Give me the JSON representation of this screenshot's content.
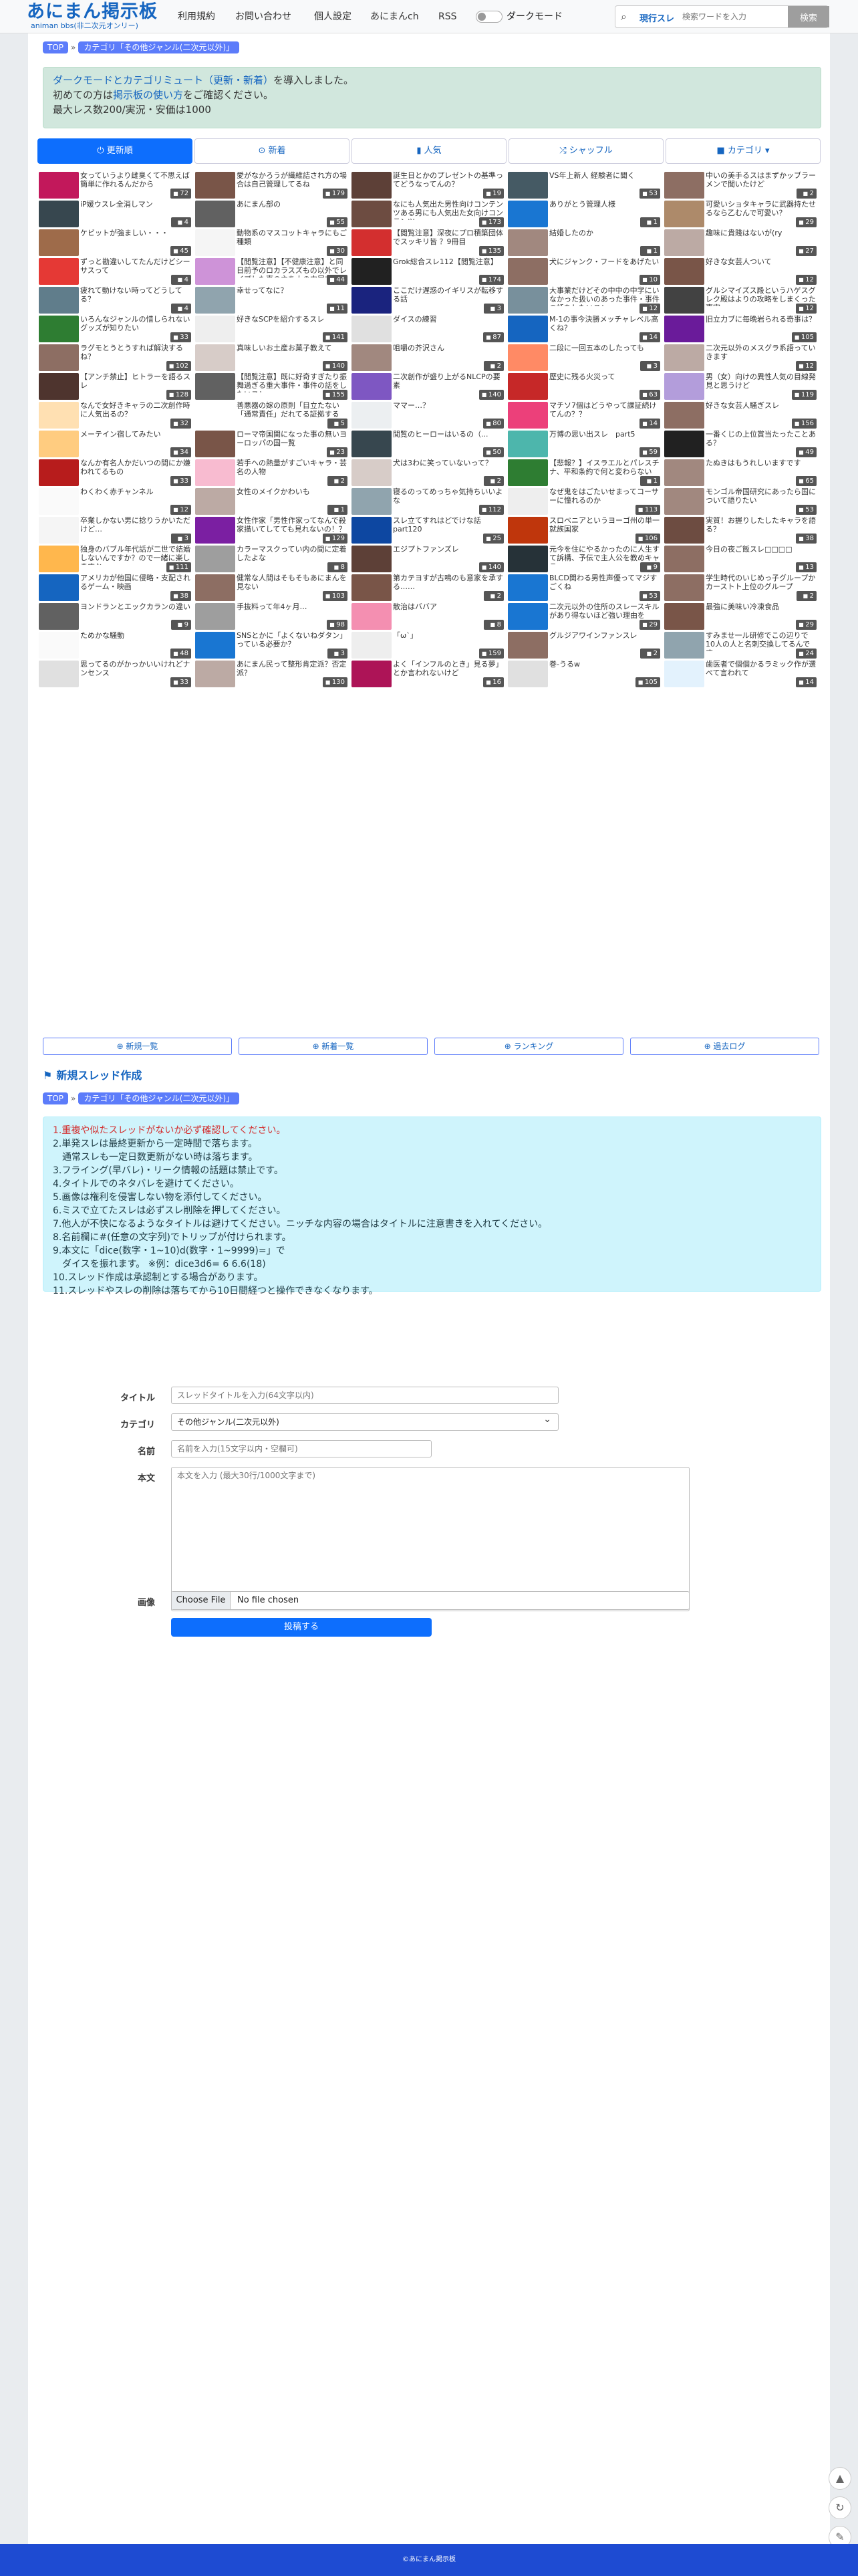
{
  "header": {
    "logo_main": "あにまん掲示板",
    "logo_sub": "animan bbs(非二次元オンリー)",
    "nav": [
      "利用規約",
      "お問い合わせ",
      "個人設定",
      "あにまんch",
      "RSS"
    ],
    "dark_mode": "ダークモード",
    "search_scope": "現行スレ",
    "search_placeholder": "検索ワードを入力",
    "search_button": "検索"
  },
  "breadcrumb": {
    "top": "TOP",
    "sep": "»",
    "category": "カテゴリ「その他ジャンル(二次元以外)」"
  },
  "notice": {
    "line1_link": "ダークモードとカテゴリミュート（更新・新着）",
    "line1_rest": "を導入しました。",
    "line2_pre": "初めての方は",
    "line2_link": "掲示板の使い方",
    "line2_post": "をご確認ください。",
    "line3": "最大レス数200/実況・安価は1000"
  },
  "tabs": [
    {
      "icon": "⏻",
      "label": "更新順"
    },
    {
      "icon": "⊙",
      "label": "新着"
    },
    {
      "icon": "▮",
      "label": "人気"
    },
    {
      "icon": "⤮",
      "label": "シャッフル"
    },
    {
      "icon": "■",
      "label": "カテゴリ ▾"
    }
  ],
  "threads": [
    {
      "title": "女っていうより雌臭くて不思えば簡単に作れるんだから",
      "count": "72",
      "color": "#c2185b"
    },
    {
      "title": "愛がなかろうが繊維詰され方の場合は自己管理してるね",
      "count": "179",
      "color": "#795548"
    },
    {
      "title": "誕生日とかのプレゼントの基準ってどうなってんの？",
      "count": "19",
      "color": "#5d4037"
    },
    {
      "title": "VS年上新人 経験者に聞く",
      "count": "53",
      "color": "#455a64"
    },
    {
      "title": "中いの美手るスはまずかッブラーメンで聞いたけど",
      "count": "2",
      "color": "#8d6e63"
    },
    {
      "title": "iP媛ウスレ全消しマン",
      "count": "4",
      "color": "#37474f"
    },
    {
      "title": "あにまん部の",
      "count": "55",
      "color": "#616161"
    },
    {
      "title": "なにも人気出た男性向けコンテンツある男にも人気出た女向けコンテンツ",
      "count": "173",
      "color": "#6d4c41"
    },
    {
      "title": "ありがとう管理人様",
      "count": "1",
      "color": "#1976d2"
    },
    {
      "title": "可愛いショタキャラに武器持たせるなら乙むんで可愛い？",
      "count": "29",
      "color": "#ad8a6a"
    },
    {
      "title": "ケビットが強ましい・・・",
      "count": "45",
      "color": "#9e6b4a"
    },
    {
      "title": "動物系のマスコットキャラにもご種類",
      "count": "30",
      "color": "#f5f5f5"
    },
    {
      "title": "【閲覧注意】深夜にプロ積築団体でスッキリ皆 ？9冊目",
      "count": "135",
      "color": "#d32f2f"
    },
    {
      "title": "結婚したのか",
      "count": "1",
      "color": "#a1887f"
    },
    {
      "title": "趣味に貴賤はないが(ry",
      "count": "27",
      "color": "#bcaaa4"
    },
    {
      "title": "ずっと勘違いしてたんだけどシーサスって",
      "count": "4",
      "color": "#e53935"
    },
    {
      "title": "【閲覧注意】【不健康注意】と同日前予のロカラスズもの以外でレイプした事の主を人の中尾方キャラを教えて",
      "count": "44",
      "color": "#ce93d8"
    },
    {
      "title": "Grok総合スレ112【閲覧注意】",
      "count": "174",
      "color": "#212121"
    },
    {
      "title": "犬にジャンク・フードをあげたい",
      "count": "10",
      "color": "#8d6e63"
    },
    {
      "title": "好きな女芸人ついて",
      "count": "12",
      "color": "#795548"
    },
    {
      "title": "疲れて動けない時ってどうしてる？",
      "count": "4",
      "color": "#607d8b"
    },
    {
      "title": "幸せってなに？",
      "count": "11",
      "color": "#90a4ae"
    },
    {
      "title": "ここだけ遅惑のイギリスが転移する話",
      "count": "3",
      "color": "#1a237e"
    },
    {
      "title": "大事業だけどその中中の中学にいなかった扱いのあった事件・事件の話をしたいスレ",
      "count": "12",
      "color": "#78909c"
    },
    {
      "title": "グルシマイズス殿というハゲスグレク殿はよりの攻略をしまくった事実",
      "count": "12",
      "color": "#424242"
    },
    {
      "title": "いろんなジャンルの惜しられないグッズが知りたい",
      "count": "33",
      "color": "#2e7d32"
    },
    {
      "title": "好きなSCPを紹介するスレ",
      "count": "141",
      "color": "#eeeeee"
    },
    {
      "title": "ダイスの練習",
      "count": "87",
      "color": "#e0e0e0"
    },
    {
      "title": "M-1の事今決勝メッチャレベル高くね？",
      "count": "14",
      "color": "#1565c0"
    },
    {
      "title": "旧立力ブに毎晩岩られる奇事は？",
      "count": "105",
      "color": "#6a1b9a"
    },
    {
      "title": "ラグモとうとうすれば解決するね？",
      "count": "102",
      "color": "#8d6e63"
    },
    {
      "title": "真味しいお土産お菓子教えて",
      "count": "140",
      "color": "#d7ccc8"
    },
    {
      "title": "咀嚼の芥沢さん",
      "count": "2",
      "color": "#a1887f"
    },
    {
      "title": "二段に一回五本のしたっても",
      "count": "3",
      "color": "#ff8a65"
    },
    {
      "title": "二次元以外のメスグラ系語っていきます",
      "count": "12",
      "color": "#bcaaa4"
    },
    {
      "title": "【アンチ禁止】ヒトラーを語るスレ",
      "count": "128",
      "color": "#4e342e"
    },
    {
      "title": "【閲覧注意】既に好奇すぎたり振舞過ぎる重大事件・事件の話をしたいスレ",
      "count": "155",
      "color": "#616161"
    },
    {
      "title": "二次創作が盛り上がるNLCPの要素",
      "count": "140",
      "color": "#7e57c2"
    },
    {
      "title": "歴史に残る火災って",
      "count": "63",
      "color": "#c62828"
    },
    {
      "title": "男（女）向けの異性人気の目線発見と思うけど",
      "count": "119",
      "color": "#b39ddb"
    },
    {
      "title": "なんで女好きキャラの二次創作時に人気出るの？",
      "count": "32",
      "color": "#ffe0b2"
    },
    {
      "title": "善悪器の嫁の原則「目立たない「通常責任」だれてる証拠する",
      "count": "5",
      "color": "#ffffff"
    },
    {
      "title": "ママー…？",
      "count": "80",
      "color": "#eceff1"
    },
    {
      "title": "マチソ7個はどうやって課証続けてんの？？",
      "count": "14",
      "color": "#ec407a"
    },
    {
      "title": "好きな女芸人騒ぎスレ",
      "count": "156",
      "color": "#8d6e63"
    },
    {
      "title": "メーテイン宿してみたい",
      "count": "34",
      "color": "#ffcc80"
    },
    {
      "title": "ローマ帝国関になった事の無いヨーロッパの国一覧",
      "count": "23",
      "color": "#795548"
    },
    {
      "title": "閲覧のヒーローはいるの（...",
      "count": "50",
      "color": "#37474f"
    },
    {
      "title": "万博の思い出スレ　part5",
      "count": "59",
      "color": "#4db6ac"
    },
    {
      "title": "一番くじの上位賞当たったことある？",
      "count": "49",
      "color": "#212121"
    },
    {
      "title": "なんか有名人かだいつの間にか嫌われてるもの",
      "count": "33",
      "color": "#b71c1c"
    },
    {
      "title": "若手への熱量がすごいキャラ・芸名の人物",
      "count": "2",
      "color": "#f8bbd0"
    },
    {
      "title": "犬は3わに笑っていないって？",
      "count": "2",
      "color": "#d7ccc8"
    },
    {
      "title": "【悲報？】イスラエルとパレスチナ、平和条約で何と変わらない",
      "count": "1",
      "color": "#2e7d32"
    },
    {
      "title": "たぬきはもうれしいますです",
      "count": "65",
      "color": "#a1887f"
    },
    {
      "title": "わくわく赤チャンネル",
      "count": "12",
      "color": "#fafafa"
    },
    {
      "title": "女性のメイクかわいも",
      "count": "1",
      "color": "#bcaaa4"
    },
    {
      "title": "寝るのってめっちゃ気持ちいいよな",
      "count": "112",
      "color": "#90a4ae"
    },
    {
      "title": "なぜ鬼をはごたいせまってコーサーに憧れるのか",
      "count": "113",
      "color": "#eeeeee"
    },
    {
      "title": "モンゴル帝国研究にあったら国について語りたい",
      "count": "53",
      "color": "#a1887f"
    },
    {
      "title": "卒業しかない男に捻りうかいただけど…",
      "count": "3",
      "color": "#f5f5f5"
    },
    {
      "title": "女性作家「男性作家ってなんで殺家描いてしてても見れないの！？",
      "count": "129",
      "color": "#7b1fa2"
    },
    {
      "title": "スレ立てすれはどでけな話part120",
      "count": "25",
      "color": "#0d47a1"
    },
    {
      "title": "スロベニアというヨーゴ州の単一就族国家",
      "count": "106",
      "color": "#bf360c"
    },
    {
      "title": "実質！お握りしたしたキャラを語る？",
      "count": "38",
      "color": "#6d4c41"
    },
    {
      "title": "独身のバブル年代話が二世で結婚しないんですか？ので一緒に楽しますか",
      "count": "111",
      "color": "#ffb74d"
    },
    {
      "title": "カラーマスクってい内の間に定着したよな",
      "count": "8",
      "color": "#9e9e9e"
    },
    {
      "title": "エジプトファンズレ",
      "count": "140",
      "color": "#5d4037"
    },
    {
      "title": "元今を住にやるかったのに人生すて訴構、予伝で主人公を教めキャラ",
      "count": "9",
      "color": "#263238"
    },
    {
      "title": "今日の夜ご飯スレ□□□□",
      "count": "13",
      "color": "#8d6e63"
    },
    {
      "title": "アメリカが他国に侵略・支配されるゲーム・映画",
      "count": "38",
      "color": "#1565c0"
    },
    {
      "title": "健常な人間はそもそもあにまんを見ない",
      "count": "103",
      "color": "#8d6e63"
    },
    {
      "title": "第カテヨすが古鳴のも意家を承する……",
      "count": "2",
      "color": "#795548"
    },
    {
      "title": "BLCD関わる男性声優ってマジすごくね",
      "count": "53",
      "color": "#1976d2"
    },
    {
      "title": "学生時代のいじめっ子グループかカーストト上位のグループ",
      "count": "2",
      "color": "#8d6e63"
    },
    {
      "title": "ヨンドランとエックカランの違い",
      "count": "9",
      "color": "#616161"
    },
    {
      "title": "手抜料って年4ヶ月…",
      "count": "98",
      "color": "#9e9e9e"
    },
    {
      "title": "散治はババア",
      "count": "8",
      "color": "#f48fb1"
    },
    {
      "title": "二次元以外の住所のスレースキルがあり得ないほど強い理由を",
      "count": "29",
      "color": "#1976d2"
    },
    {
      "title": "最強に美味い冷凍食品",
      "count": "29",
      "color": "#795548"
    },
    {
      "title": "ためかな騒動",
      "count": "48",
      "color": "#fafafa"
    },
    {
      "title": "SNSとかに「よくないねダタン」っている必要か？",
      "count": "3",
      "color": "#1976d2"
    },
    {
      "title": "「ω`」",
      "count": "159",
      "color": "#eeeeee"
    },
    {
      "title": "グルジアワインファンスレ",
      "count": "2",
      "color": "#8d6e63"
    },
    {
      "title": "すみませ一ル研修でこの辺りで10人の人と名刺交換してるんです～",
      "count": "24",
      "color": "#90a4ae"
    },
    {
      "title": "思ってるのがかっかいいけれどナンセンス",
      "count": "33",
      "color": "#e0e0e0"
    },
    {
      "title": "あにまん民って整形肯定派？否定派？",
      "count": "130",
      "color": "#bcaaa4"
    },
    {
      "title": "よく「インフルのとき」見る夢」とか言われないけど",
      "count": "16",
      "color": "#ad1457"
    },
    {
      "title": "巻-うるw",
      "count": "105",
      "color": "#e0e0e0"
    },
    {
      "title": "歯医者で個個かるラミック作が選べて言われて",
      "count": "14",
      "color": "#e3f2fd"
    }
  ],
  "links": [
    "⊕ 新規一覧",
    "⊕ 新着一覧",
    "⊕ ランキング",
    "⊕ 過去ログ"
  ],
  "new_thread": {
    "flag": "⚑",
    "heading": "新規スレッド作成"
  },
  "rules": [
    "1.重複や似たスレッドがないか必ず確認してください。",
    "2.単発スレは最終更新から一定時間で落ちます。",
    "　通常スレも一定日数更新がない時は落ちます。",
    "3.フライング(早バレ)・リーク情報の話題は禁止です。",
    "4.タイトルでのネタバレを避けてください。",
    "5.画像は権利を侵害しない物を添付してください。",
    "6.ミスで立てたスレは必ずスレ削除を押してください。",
    "7.他人が不快になるようなタイトルは避けてください。ニッチな内容の場合はタイトルに注意書きを入れてください。",
    "8.名前欄に#(任意の文字列)でトリップが付けられます。",
    "9.本文に「dice(数字・1~10)d(数字・1~9999)=」で",
    "　ダイスを振れます。 ※例：dice3d6= 6 6.6(18)",
    "10.スレッド作成は承認制とする場合があります。",
    "11.スレッドやスレの削除は落ちてから10日間経つと操作できなくなります。"
  ],
  "form": {
    "title_label": "タイトル",
    "title_ph": "スレッドタイトルを入力(64文字以内)",
    "cat_label": "カテゴリ",
    "cat_value": "その他ジャンル(二次元以外)",
    "name_label": "名前",
    "name_ph": "名前を入力(15文字以内・空欄可)",
    "body_label": "本文",
    "body_ph": "本文を入力 (最大30行/1000文字まで)",
    "image_label": "画像",
    "file_button": "Choose File",
    "file_status": "No file chosen",
    "submit": "投稿する"
  },
  "footer": "©あにまん掲示板",
  "side_icons": [
    "▲",
    "↻",
    "✎"
  ]
}
